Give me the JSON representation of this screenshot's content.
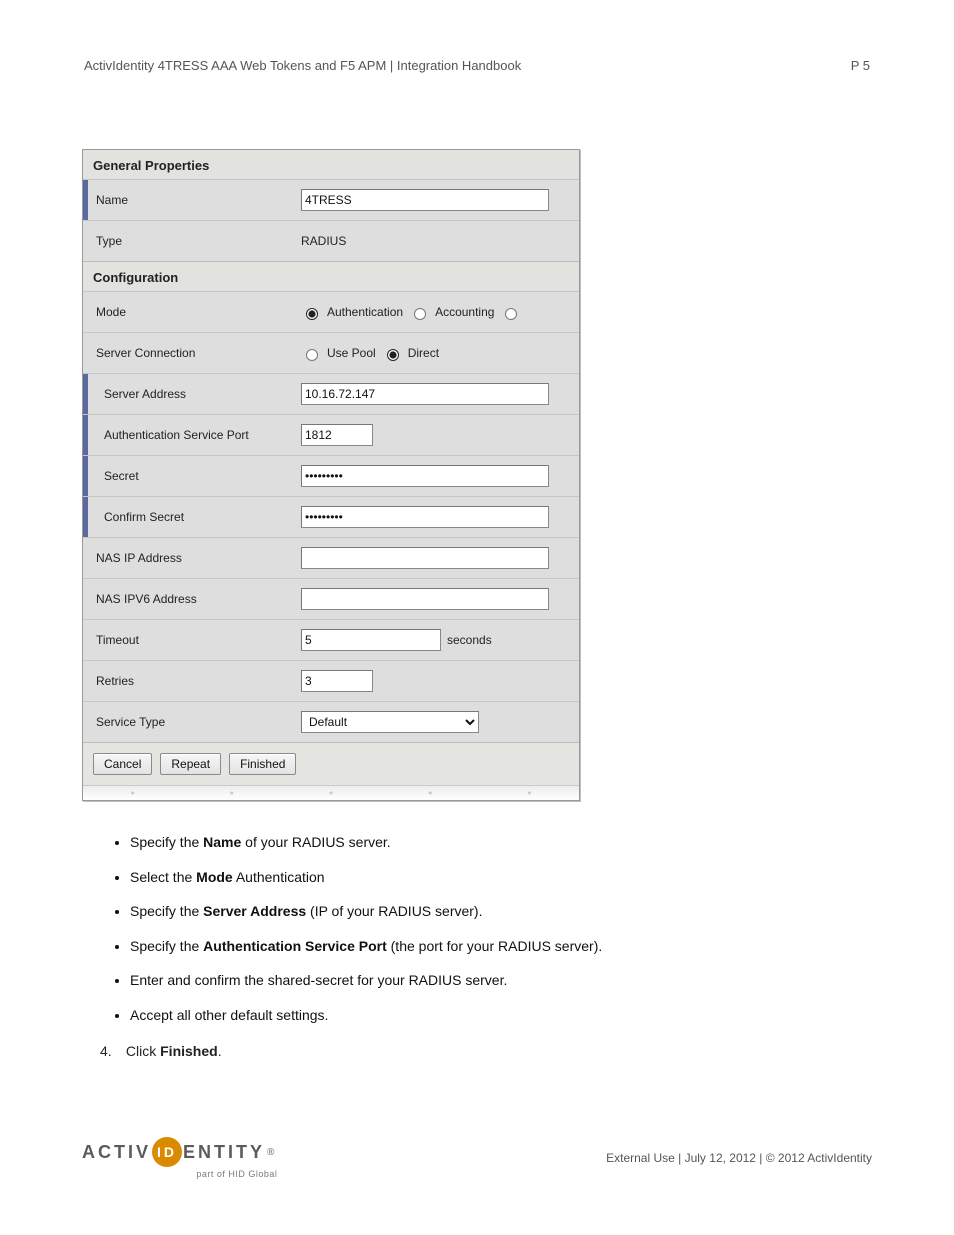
{
  "doc": {
    "title": "ActivIdentity 4TRESS AAA Web Tokens and F5 APM | Integration Handbook",
    "page_label": "P 5"
  },
  "form": {
    "sections": {
      "general": "General Properties",
      "config": "Configuration"
    },
    "labels": {
      "name": "Name",
      "type": "Type",
      "mode": "Mode",
      "server_conn": "Server Connection",
      "server_addr": "Server Address",
      "auth_port": "Authentication Service Port",
      "secret": "Secret",
      "confirm_secret": "Confirm Secret",
      "nas_ip": "NAS IP Address",
      "nas_ipv6": "NAS IPV6 Address",
      "timeout": "Timeout",
      "retries": "Retries",
      "service_type": "Service Type"
    },
    "values": {
      "name": "4TRESS",
      "type": "RADIUS",
      "server_addr": "10.16.72.147",
      "auth_port": "1812",
      "secret": "•••••••••",
      "confirm_secret": "•••••••••",
      "nas_ip": "",
      "nas_ipv6": "",
      "timeout": "5",
      "timeout_unit": "seconds",
      "retries": "3",
      "service_type": "Default"
    },
    "radios": {
      "mode_auth": "Authentication",
      "mode_acct": "Accounting",
      "conn_pool": "Use Pool",
      "conn_direct": "Direct"
    },
    "buttons": {
      "cancel": "Cancel",
      "repeat": "Repeat",
      "finished": "Finished"
    }
  },
  "instructions": {
    "i1_pre": "Specify the ",
    "i1_b": "Name",
    "i1_post": " of your RADIUS server.",
    "i2_pre": "Select the ",
    "i2_b": "Mode",
    "i2_post": " Authentication",
    "i3_pre": "Specify the ",
    "i3_b": "Server Address",
    "i3_post": " (IP of your RADIUS server).",
    "i4_pre": "Specify the ",
    "i4_b": "Authentication Service Port",
    "i4_post": " (the port for your RADIUS server).",
    "i5": "Enter and confirm the shared-secret for your RADIUS server.",
    "i6": "Accept all other default settings.",
    "step4_num": "4.",
    "step4_pre": "Click ",
    "step4_b": "Finished",
    "step4_post": "."
  },
  "footer": {
    "text": "External Use | July 12, 2012 | © 2012 ActivIdentity",
    "logo_left": "ACTIV",
    "logo_mid": "ID",
    "logo_right": "ENTITY",
    "logo_sub": "part of HID Global"
  }
}
